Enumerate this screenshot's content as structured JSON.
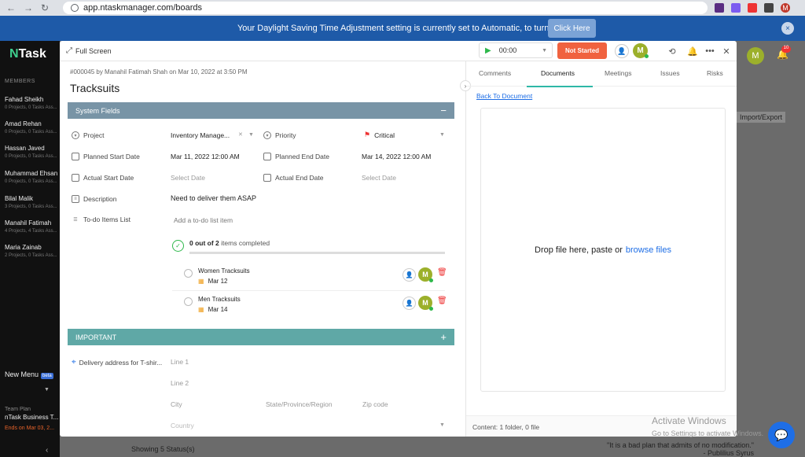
{
  "browser": {
    "url": "app.ntaskmanager.com/boards",
    "profile_initial": "M"
  },
  "banner": {
    "message": "Your Daylight Saving Time Adjustment setting is currently set to Automatic, to turn it off",
    "button_label": "Click Here",
    "close": "×"
  },
  "sidebar": {
    "logo_mark": "N",
    "logo_text": "Task",
    "members_title": "MEMBERS",
    "members": [
      {
        "name": "Fahad Sheikh",
        "stats": "0 Projects, 0 Tasks Ass..."
      },
      {
        "name": "Amad Rehan",
        "stats": "0 Projects, 0 Tasks Ass..."
      },
      {
        "name": "Hassan Javed",
        "stats": "0 Projects, 0 Tasks Ass..."
      },
      {
        "name": "Muhammad Ehsan",
        "stats": "0 Projects, 0 Tasks Ass..."
      },
      {
        "name": "Bilal Malik",
        "stats": "3 Projects, 0 Tasks Ass..."
      },
      {
        "name": "Manahil Fatimah",
        "stats": "4 Projects, 4 Tasks Ass..."
      },
      {
        "name": "Maria Zainab",
        "stats": "2 Projects, 0 Tasks Ass..."
      }
    ],
    "new_menu": "New Menu",
    "new_menu_badge": "beta",
    "team_plan_label": "Team Plan",
    "team_name": "nTask Business T...",
    "plan_ends": "Ends on Mar 03, 2..."
  },
  "background": {
    "import_export": "Import/Export",
    "status_text": "Showing 5 Status(s)",
    "quote": "\"It is a bad plan that admits of no modification.\"",
    "quote_author": "- Publilius Syrus",
    "avatar_initial": "M",
    "notif_count": "10",
    "activate_title": "Activate Windows",
    "activate_sub": "Go to Settings to activate Windows."
  },
  "modal": {
    "fullscreen_label": "Full Screen",
    "timer": "00:00",
    "status": "Not Started",
    "avatar_initial": "M",
    "task_meta": "#000045 by Manahil Fatimah Shah on Mar 10, 2022 at 3:50 PM",
    "task_title": "Tracksuits",
    "system_fields_title": "System Fields",
    "fields": {
      "project_label": "Project",
      "project_value": "Inventory Manage...",
      "priority_label": "Priority",
      "priority_value": "Critical",
      "planned_start_label": "Planned Start Date",
      "planned_start_value": "Mar 11, 2022 12:00 AM",
      "planned_end_label": "Planned End Date",
      "planned_end_value": "Mar 14, 2022 12:00 AM",
      "actual_start_label": "Actual Start Date",
      "actual_start_placeholder": "Select Date",
      "actual_end_label": "Actual End Date",
      "actual_end_placeholder": "Select Date",
      "description_label": "Description",
      "description_value": "Need to deliver them ASAP",
      "todo_label": "To-do Items List",
      "todo_placeholder": "Add a to-do list item"
    },
    "todo_progress": {
      "completed": "0 out of 2",
      "suffix": "items completed"
    },
    "todos": [
      {
        "name": "Women Tracksuits",
        "date": "Mar 12",
        "avatar": "M"
      },
      {
        "name": "Men Tracksuits",
        "date": "Mar 14",
        "avatar": "M"
      }
    ],
    "important_title": "IMPORTANT",
    "address": {
      "label": "Delivery address for T-shir...",
      "line1": "Line 1",
      "line2": "Line 2",
      "city": "City",
      "state": "State/Province/Region",
      "zip": "Zip code",
      "country": "Country"
    },
    "tabs": [
      "Comments",
      "Documents",
      "Meetings",
      "Issues",
      "Risks"
    ],
    "active_tab": "Documents",
    "back_link": "Back To Document",
    "dropzone_text": "Drop file here, paste or",
    "dropzone_link": "browse files",
    "content_footer": "Content: 1 folder, 0 file"
  }
}
